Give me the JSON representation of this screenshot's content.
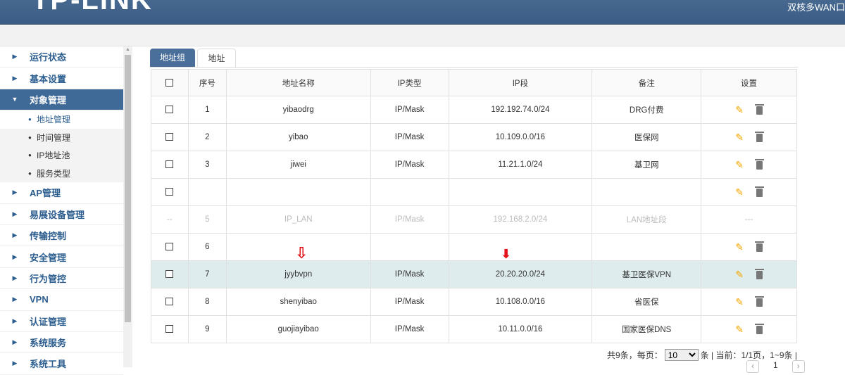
{
  "header": {
    "logo": "TP-LINK",
    "model": "双核多WAN口"
  },
  "sidebar": {
    "items": [
      {
        "label": "运行状态"
      },
      {
        "label": "基本设置"
      },
      {
        "label": "对象管理",
        "expanded": true,
        "children": [
          "地址管理",
          "时间管理",
          "IP地址池",
          "服务类型"
        ]
      },
      {
        "label": "AP管理"
      },
      {
        "label": "易展设备管理"
      },
      {
        "label": "传输控制"
      },
      {
        "label": "安全管理"
      },
      {
        "label": "行为管控"
      },
      {
        "label": "VPN"
      },
      {
        "label": "认证管理"
      },
      {
        "label": "系统服务"
      },
      {
        "label": "系统工具"
      }
    ]
  },
  "tabs": [
    "地址组",
    "地址"
  ],
  "table": {
    "headers": [
      "序号",
      "地址名称",
      "IP类型",
      "IP段",
      "备注",
      "设置"
    ],
    "rows": [
      {
        "no": "1",
        "name": "yibaodrg",
        "type": "IP/Mask",
        "ip": "192.192.74.0/24",
        "note": "DRG付费"
      },
      {
        "no": "2",
        "name": "yibao",
        "type": "IP/Mask",
        "ip": "10.109.0.0/16",
        "note": "医保网"
      },
      {
        "no": "3",
        "name": "jiwei",
        "type": "IP/Mask",
        "ip": "11.21.1.0/24",
        "note": "基卫网"
      },
      {
        "no": "",
        "name": "",
        "type": "",
        "ip": "",
        "note": ""
      },
      {
        "no": "5",
        "name": "IP_LAN",
        "type": "IP/Mask",
        "ip": "192.168.2.0/24",
        "note": "LAN地址段",
        "disabled": true,
        "check": "--",
        "settings": "---"
      },
      {
        "no": "6",
        "name": "",
        "type": "",
        "ip": "",
        "note": ""
      },
      {
        "no": "7",
        "name": "jyybvpn",
        "type": "IP/Mask",
        "ip": "20.20.20.0/24",
        "note": "基卫医保VPN",
        "highlight": true
      },
      {
        "no": "8",
        "name": "shenyibao",
        "type": "IP/Mask",
        "ip": "10.108.0.0/16",
        "note": "省医保"
      },
      {
        "no": "9",
        "name": "guojiayibao",
        "type": "IP/Mask",
        "ip": "10.11.0.0/16",
        "note": "国家医保DNS"
      }
    ]
  },
  "pager": {
    "total": "共9条，每页：",
    "per_page": "10",
    "unit": "条 | 当前：1/1页，1~9条 |",
    "page": "1",
    "prev": "‹",
    "next": "›"
  },
  "colors": {
    "header": "#3f6189",
    "selected": "#3f6a98",
    "highlight": "#dfeced",
    "arrow": "#e3101a"
  }
}
